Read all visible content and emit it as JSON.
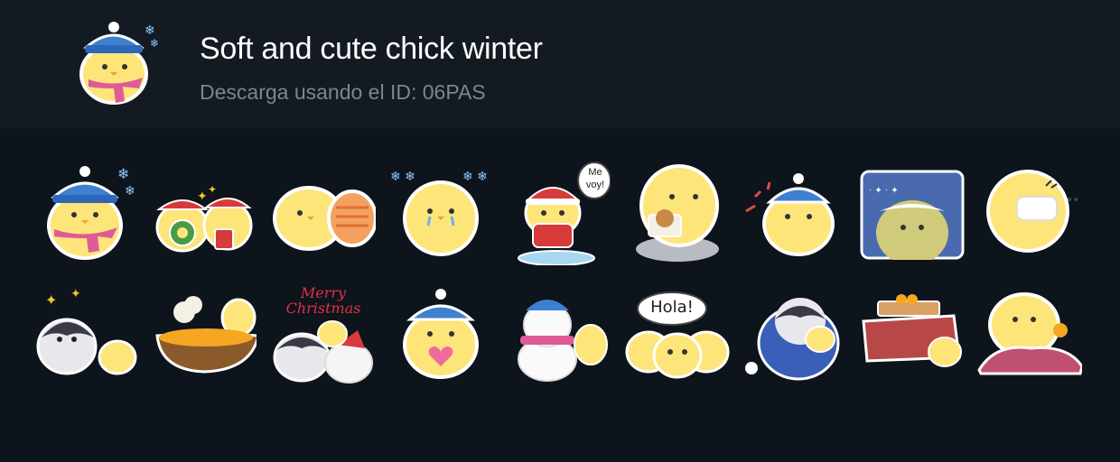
{
  "header": {
    "title": "Soft and cute chick winter",
    "subtitle": "Descarga usando el ID: 06PAS"
  },
  "colors": {
    "background": "#0d141b",
    "header_background": "#131a21",
    "title": "#ffffff",
    "subtitle": "#7d8590",
    "chick_yellow": "#fde57a",
    "outline": "#ffffff"
  },
  "stickers": [
    {
      "name": "chick-blue-hat-pink-scarf-snow"
    },
    {
      "name": "chicks-christmas-wreath-and-mug"
    },
    {
      "name": "chick-with-warm-heater"
    },
    {
      "name": "chick-crying-snowflakes"
    },
    {
      "name": "chick-santa-skating",
      "text": "Me voy!"
    },
    {
      "name": "chick-with-bread"
    },
    {
      "name": "chick-blue-hat-surprised"
    },
    {
      "name": "chick-covered-in-snow"
    },
    {
      "name": "chick-wearing-mask"
    },
    {
      "name": "penguin-and-chick-sparkles"
    },
    {
      "name": "chick-with-soup-bowl"
    },
    {
      "name": "merry-christmas-penguin-and-seal",
      "text": "Merry Christmas"
    },
    {
      "name": "chick-blue-hat-heart"
    },
    {
      "name": "chick-with-snowman"
    },
    {
      "name": "three-chicks-hola",
      "text": "Hola!"
    },
    {
      "name": "penguin-blue-scarf-with-chick"
    },
    {
      "name": "chick-under-kotatsu"
    },
    {
      "name": "chick-under-blanket"
    }
  ]
}
